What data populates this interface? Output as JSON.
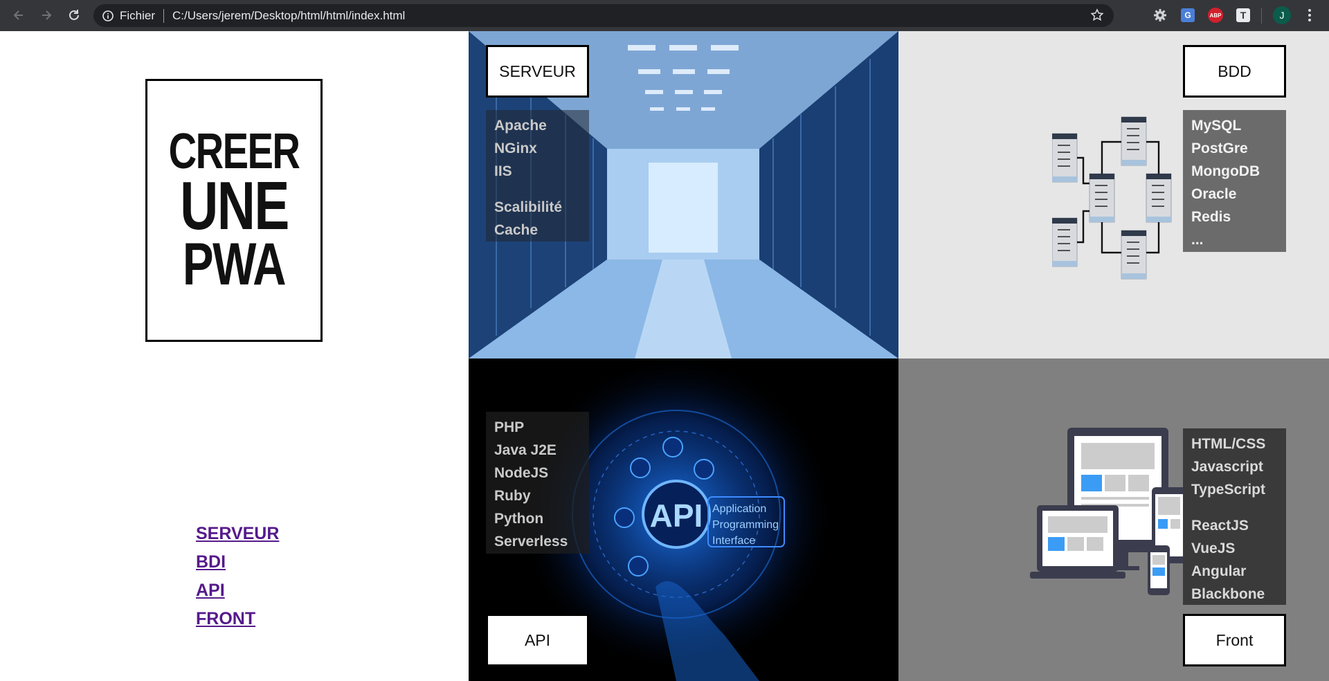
{
  "browser": {
    "security_label": "Fichier",
    "url": "C:/Users/jerem/Desktop/html/html/index.html",
    "profile_initial": "J",
    "ext_translate": "G",
    "ext_abp": "ABP",
    "ext_t": "T"
  },
  "poster": {
    "line1": "CREER",
    "line2": "UNE",
    "line3": "PWA"
  },
  "menu": {
    "items": [
      "SERVEUR",
      "BDI",
      "API",
      "FRONT"
    ]
  },
  "server": {
    "title": "SERVEUR",
    "list_a": [
      "Apache",
      "NGinx",
      "IIS"
    ],
    "list_b": [
      "Scalibilité",
      "Cache"
    ]
  },
  "bdd": {
    "title": "BDD",
    "list": [
      "MySQL",
      "PostGre",
      "MongoDB",
      "Oracle",
      "Redis",
      "..."
    ]
  },
  "api": {
    "title": "API",
    "list": [
      "PHP",
      "Java J2E",
      "NodeJS",
      "Ruby",
      "Python",
      "Serverless"
    ],
    "graphic_text": "API",
    "graphic_caption": [
      "Application",
      "Programming",
      "Interface"
    ]
  },
  "front": {
    "title": "Front",
    "list_a": [
      "HTML/CSS",
      "Javascript",
      "TypeScript"
    ],
    "list_b": [
      "ReactJS",
      "VueJS",
      "Angular",
      "Blackbone"
    ]
  },
  "colors": {
    "link": "#551a8b",
    "chrome": "#35363a",
    "omnibox": "#202124"
  }
}
